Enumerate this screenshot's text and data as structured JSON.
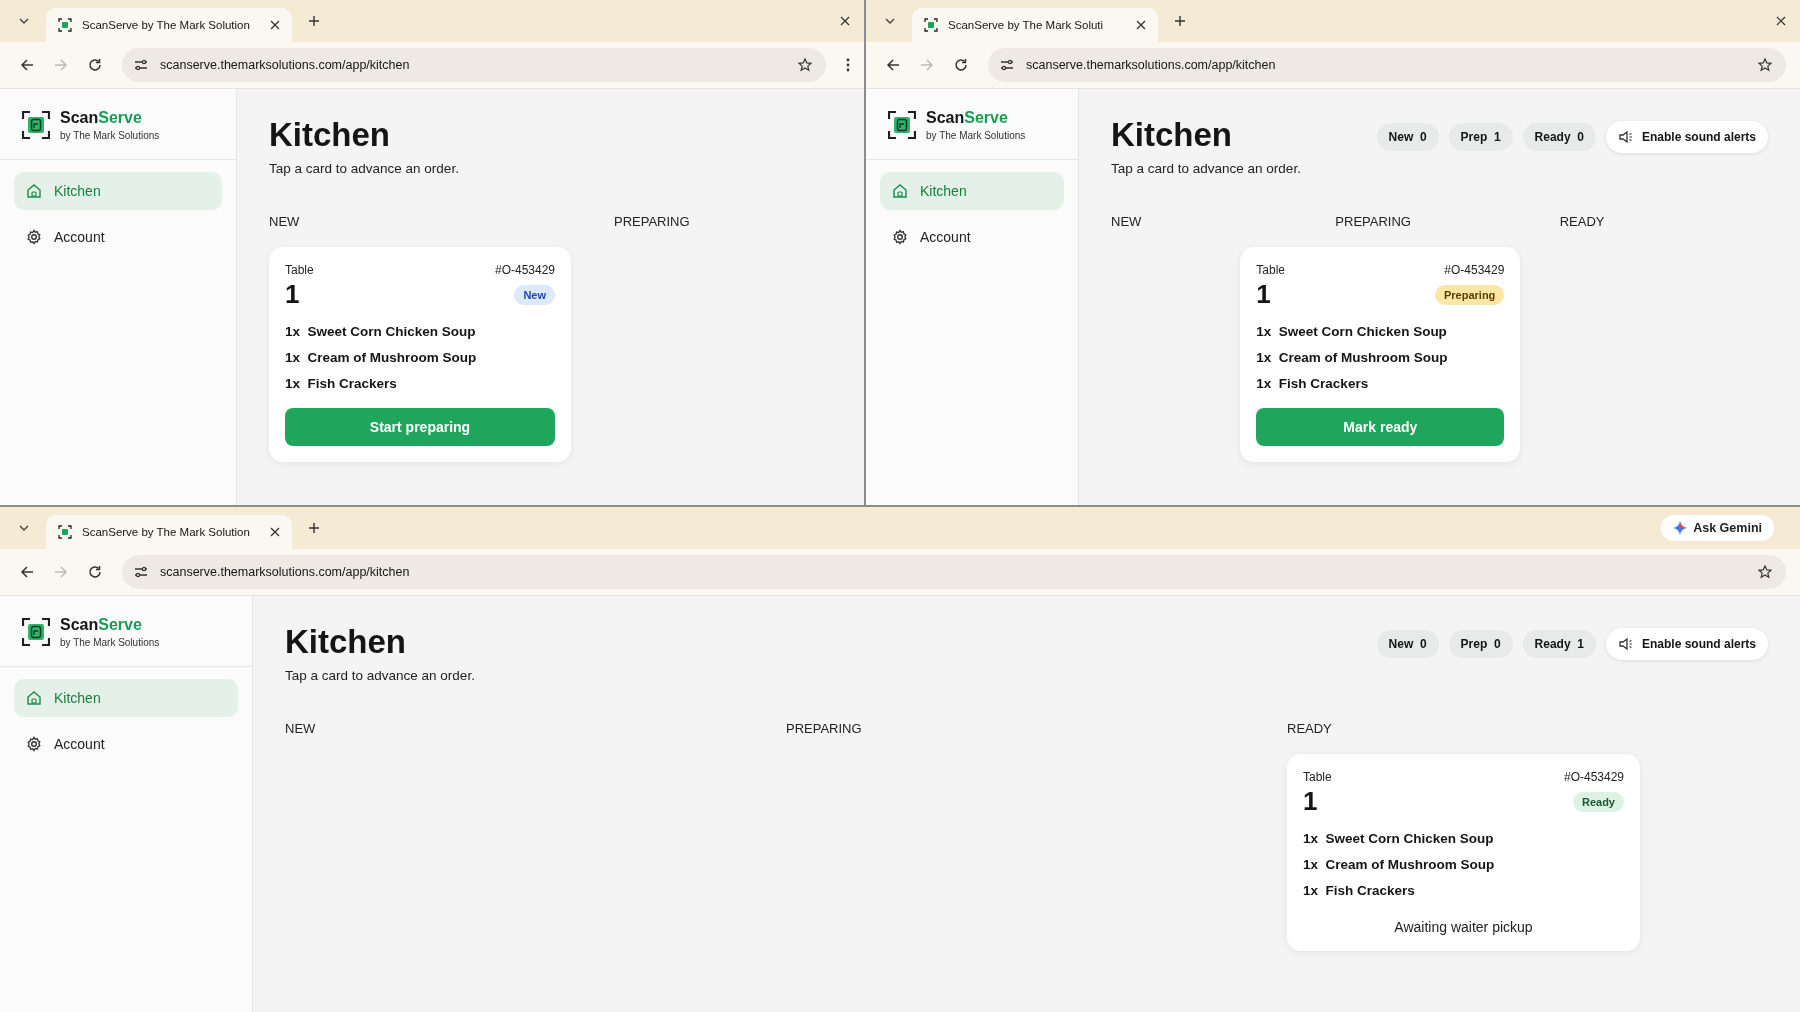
{
  "windows": [
    {
      "tab_title": "ScanServe by The Mark Solution",
      "url": "scanserve.themarksolutions.com/app/kitchen",
      "close_button": true,
      "menu_button": true,
      "sidebar": {
        "brand": "Scan",
        "brand_accent": "Serve",
        "byline": "by The Mark Solutions",
        "items": [
          {
            "label": "Kitchen",
            "kind": "kitchen",
            "selected": true
          },
          {
            "label": "Account",
            "kind": "account",
            "selected": false
          }
        ]
      },
      "page": {
        "title": "Kitchen",
        "subtitle": "Tap a card to advance an order.",
        "columns": [
          {
            "heading": "NEW",
            "cards": [
              {
                "table_label": "Table",
                "table_number": "1",
                "order_id": "#O-453429",
                "status": {
                  "label": "New",
                  "kind": "new"
                },
                "items": [
                  {
                    "qty": "1x",
                    "name": "Sweet Corn Chicken Soup"
                  },
                  {
                    "qty": "1x",
                    "name": "Cream of Mushroom Soup"
                  },
                  {
                    "qty": "1x",
                    "name": "Fish Crackers"
                  }
                ],
                "action": {
                  "kind": "button",
                  "label": "Start preparing"
                }
              }
            ]
          },
          {
            "heading": "PREPARING"
          }
        ]
      }
    },
    {
      "tab_title": "ScanServe by The Mark Soluti",
      "url": "scanserve.themarksolutions.com/app/kitchen",
      "close_button": true,
      "menu_button": false,
      "sidebar": {
        "brand": "Scan",
        "brand_accent": "Serve",
        "byline": "by The Mark Solutions",
        "items": [
          {
            "label": "Kitchen",
            "kind": "kitchen",
            "selected": true
          },
          {
            "label": "Account",
            "kind": "account",
            "selected": false
          }
        ]
      },
      "page": {
        "title": "Kitchen",
        "subtitle": "Tap a card to advance an order.",
        "stats": [
          {
            "label": "New",
            "count": "0"
          },
          {
            "label": "Prep",
            "count": "1"
          },
          {
            "label": "Ready",
            "count": "0"
          }
        ],
        "sound_button": "Enable sound alerts",
        "columns": [
          {
            "heading": "NEW"
          },
          {
            "heading": "PREPARING",
            "cards": [
              {
                "table_label": "Table",
                "table_number": "1",
                "order_id": "#O-453429",
                "status": {
                  "label": "Preparing",
                  "kind": "preparing"
                },
                "items": [
                  {
                    "qty": "1x",
                    "name": "Sweet Corn Chicken Soup"
                  },
                  {
                    "qty": "1x",
                    "name": "Cream of Mushroom Soup"
                  },
                  {
                    "qty": "1x",
                    "name": "Fish Crackers"
                  }
                ],
                "action": {
                  "kind": "button",
                  "label": "Mark ready"
                }
              }
            ]
          },
          {
            "heading": "READY"
          }
        ]
      }
    },
    {
      "tab_title": "ScanServe by The Mark Solution",
      "url": "scanserve.themarksolutions.com/app/kitchen",
      "close_button": false,
      "menu_button": false,
      "assistant_button": "Ask Gemini",
      "sidebar": {
        "brand": "Scan",
        "brand_accent": "Serve",
        "byline": "by The Mark Solutions",
        "items": [
          {
            "label": "Kitchen",
            "kind": "kitchen",
            "selected": true
          },
          {
            "label": "Account",
            "kind": "account",
            "selected": false
          }
        ]
      },
      "page": {
        "title": "Kitchen",
        "subtitle": "Tap a card to advance an order.",
        "stats": [
          {
            "label": "New",
            "count": "0"
          },
          {
            "label": "Prep",
            "count": "0"
          },
          {
            "label": "Ready",
            "count": "1"
          }
        ],
        "sound_button": "Enable sound alerts",
        "columns": [
          {
            "heading": "NEW"
          },
          {
            "heading": "PREPARING"
          },
          {
            "heading": "READY",
            "cards": [
              {
                "table_label": "Table",
                "table_number": "1",
                "order_id": "#O-453429",
                "status": {
                  "label": "Ready",
                  "kind": "ready"
                },
                "items": [
                  {
                    "qty": "1x",
                    "name": "Sweet Corn Chicken Soup"
                  },
                  {
                    "qty": "1x",
                    "name": "Cream of Mushroom Soup"
                  },
                  {
                    "qty": "1x",
                    "name": "Fish Crackers"
                  }
                ],
                "action": {
                  "kind": "note",
                  "label": "Awaiting waiter pickup"
                }
              }
            ]
          }
        ]
      }
    }
  ]
}
